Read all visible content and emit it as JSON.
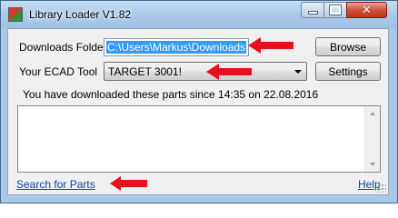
{
  "window": {
    "title": "Library Loader V1.82"
  },
  "downloads": {
    "label": "Downloads Folder",
    "value": "C:\\Users\\Markus\\Downloads",
    "browse_label": "Browse"
  },
  "ecad": {
    "label": "Your ECAD Tool",
    "selected": "TARGET 3001!",
    "settings_label": "Settings"
  },
  "status": {
    "text": "You have downloaded these parts since 14:35 on 22.08.2016"
  },
  "parts_list": {
    "items": []
  },
  "footer": {
    "search_link": "Search for Parts",
    "help_link": "Help"
  },
  "annotations": {
    "arrow_color": "#e8101f"
  }
}
